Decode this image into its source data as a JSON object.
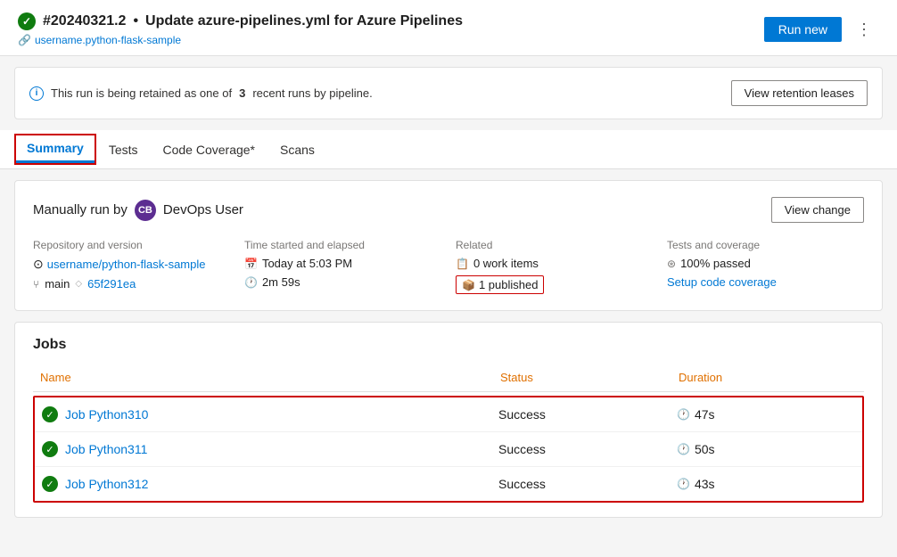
{
  "header": {
    "run_id": "#20240321.2",
    "separator": "•",
    "title": "Update azure-pipelines.yml for Azure Pipelines",
    "repo_link": "username.python-flask-sample",
    "run_button_label": "Run new",
    "more_icon": "⋮"
  },
  "retention": {
    "message": "This run is being retained as one of",
    "count": "3",
    "message2": "recent runs by pipeline.",
    "button_label": "View retention leases"
  },
  "tabs": [
    {
      "label": "Summary",
      "active": true
    },
    {
      "label": "Tests",
      "active": false
    },
    {
      "label": "Code Coverage*",
      "active": false
    },
    {
      "label": "Scans",
      "active": false
    }
  ],
  "summary": {
    "manually_run_text": "Manually run by",
    "user_initials": "CB",
    "user_name": "DevOps User",
    "view_change_label": "View change",
    "meta": {
      "repo_label": "Repository and version",
      "repo_value": "username/python-flask-sample",
      "branch": "main",
      "commit": "65f291ea",
      "time_label": "Time started and elapsed",
      "time_value": "Today at 5:03 PM",
      "elapsed": "2m 59s",
      "related_label": "Related",
      "work_items": "0 work items",
      "published": "1 published",
      "tests_label": "Tests and coverage",
      "tests_passed": "100% passed",
      "setup_coverage": "Setup code coverage"
    }
  },
  "jobs": {
    "title": "Jobs",
    "columns": [
      "Name",
      "Status",
      "Duration"
    ],
    "rows": [
      {
        "name": "Job Python310",
        "status": "Success",
        "duration": "47s"
      },
      {
        "name": "Job Python311",
        "status": "Success",
        "duration": "50s"
      },
      {
        "name": "Job Python312",
        "status": "Success",
        "duration": "43s"
      }
    ]
  },
  "colors": {
    "success": "#107c10",
    "accent": "#0078d4",
    "highlight_border": "#cc0000",
    "orange_label": "#e07000"
  }
}
